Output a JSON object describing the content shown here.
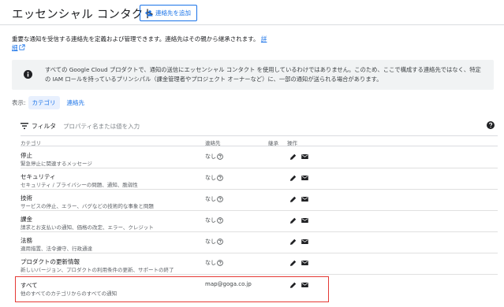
{
  "header": {
    "title": "エッセンシャル コンタクト",
    "add_button_label": "連絡先を追加"
  },
  "description": {
    "text": "重要な通知を受信する連絡先を定義および管理できます。連絡先はその親から継承されます。",
    "link": "詳細"
  },
  "banner": {
    "icon": "info-icon",
    "text": "すべての Google Cloud プロダクトで、通知の送信にエッセンシャル コンタクト を使用しているわけではありません。このため、ここで構成する連絡先ではなく、特定の IAM ロールを持っているプリンシパル（課金管理者やプロジェクト オーナーなど）に、一部の通知が送られる場合があります。"
  },
  "view": {
    "label": "表示:",
    "chips": [
      "カテゴリ",
      "連絡先"
    ],
    "active": "カテゴリ"
  },
  "filter": {
    "label": "フィルタ",
    "placeholder": "プロパティ名または値を入力"
  },
  "table": {
    "columns": {
      "category": "カテゴリ",
      "contact": "連絡先",
      "inherit": "継承",
      "actions": "操作"
    },
    "rows": [
      {
        "name": "停止",
        "desc": "緊急停止に関連するメッセージ",
        "contact": "なし"
      },
      {
        "name": "セキュリティ",
        "desc": "セキュリティ / プライバシーの問題、通知、脆弱性",
        "contact": "なし"
      },
      {
        "name": "技術",
        "desc": "サービスの停止、エラー、バグなどの技術的な事象と問題",
        "contact": "なし"
      },
      {
        "name": "課金",
        "desc": "請求とお支払いの通知、価格の改定、エラー、クレジット",
        "contact": "なし"
      },
      {
        "name": "法務",
        "desc": "適用措置、法令遵守、行政通達",
        "contact": "なし"
      },
      {
        "name": "プロダクトの更新情報",
        "desc": "新しいバージョン、プロダクトの利用条件の更新、サポートの終了",
        "contact": "なし"
      },
      {
        "name": "すべて",
        "desc": "他のすべてのカテゴリからのすべての通知",
        "contact": "map@goga.co.jp"
      }
    ]
  },
  "colors": {
    "accent": "#1a73e8",
    "highlight_border": "#e53935",
    "banner_bg": "#f1f3f4"
  }
}
